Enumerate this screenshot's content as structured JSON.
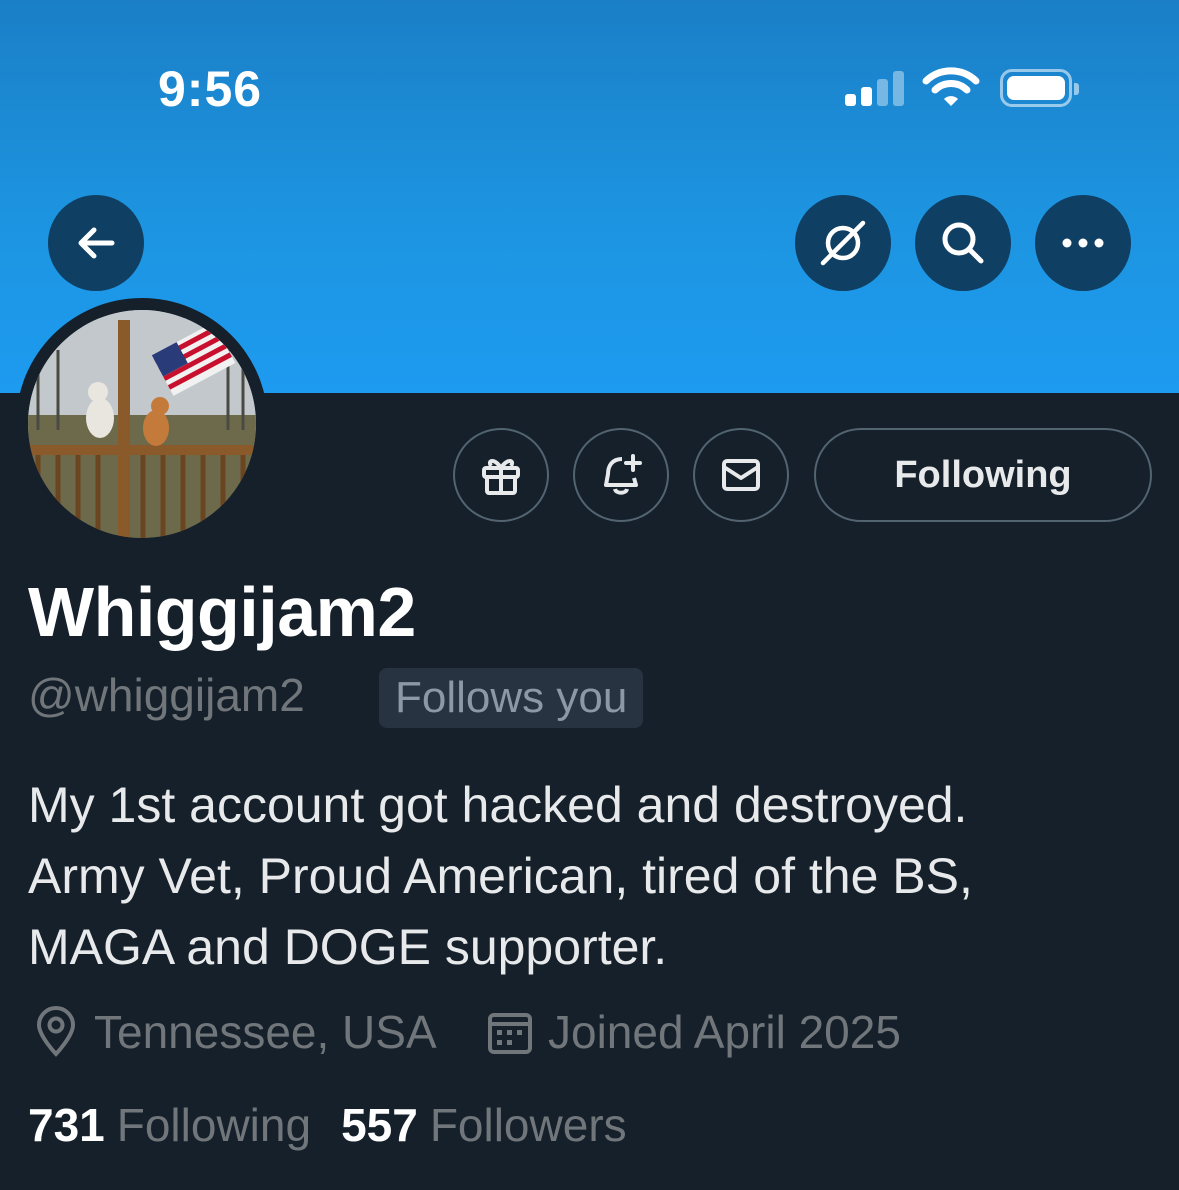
{
  "status_bar": {
    "time": "9:56"
  },
  "nav": {
    "back_icon": "arrow-left-icon",
    "grok_icon": "slash-circle-icon",
    "search_icon": "search-icon",
    "more_icon": "more-horizontal-icon"
  },
  "actions": {
    "gift_icon": "gift-icon",
    "notify_icon": "bell-plus-icon",
    "message_icon": "envelope-icon",
    "follow_label": "Following"
  },
  "profile": {
    "display_name": "Whiggijam2",
    "handle": "@whiggijam2",
    "follows_you": "Follows you",
    "bio_lines": [
      "My 1st account got hacked and destroyed.",
      "Army Vet, Proud American, tired of the BS,",
      "MAGA and DOGE supporter."
    ],
    "location": "Tennessee, USA",
    "joined": "Joined April 2025",
    "following_count": "731",
    "following_label": "Following",
    "followers_count": "557",
    "followers_label": "Followers"
  },
  "colors": {
    "banner": "#1d9bf0",
    "background": "#15202b",
    "button_dark": "#0f3f63",
    "border": "#536471",
    "muted_text": "#71767b"
  }
}
